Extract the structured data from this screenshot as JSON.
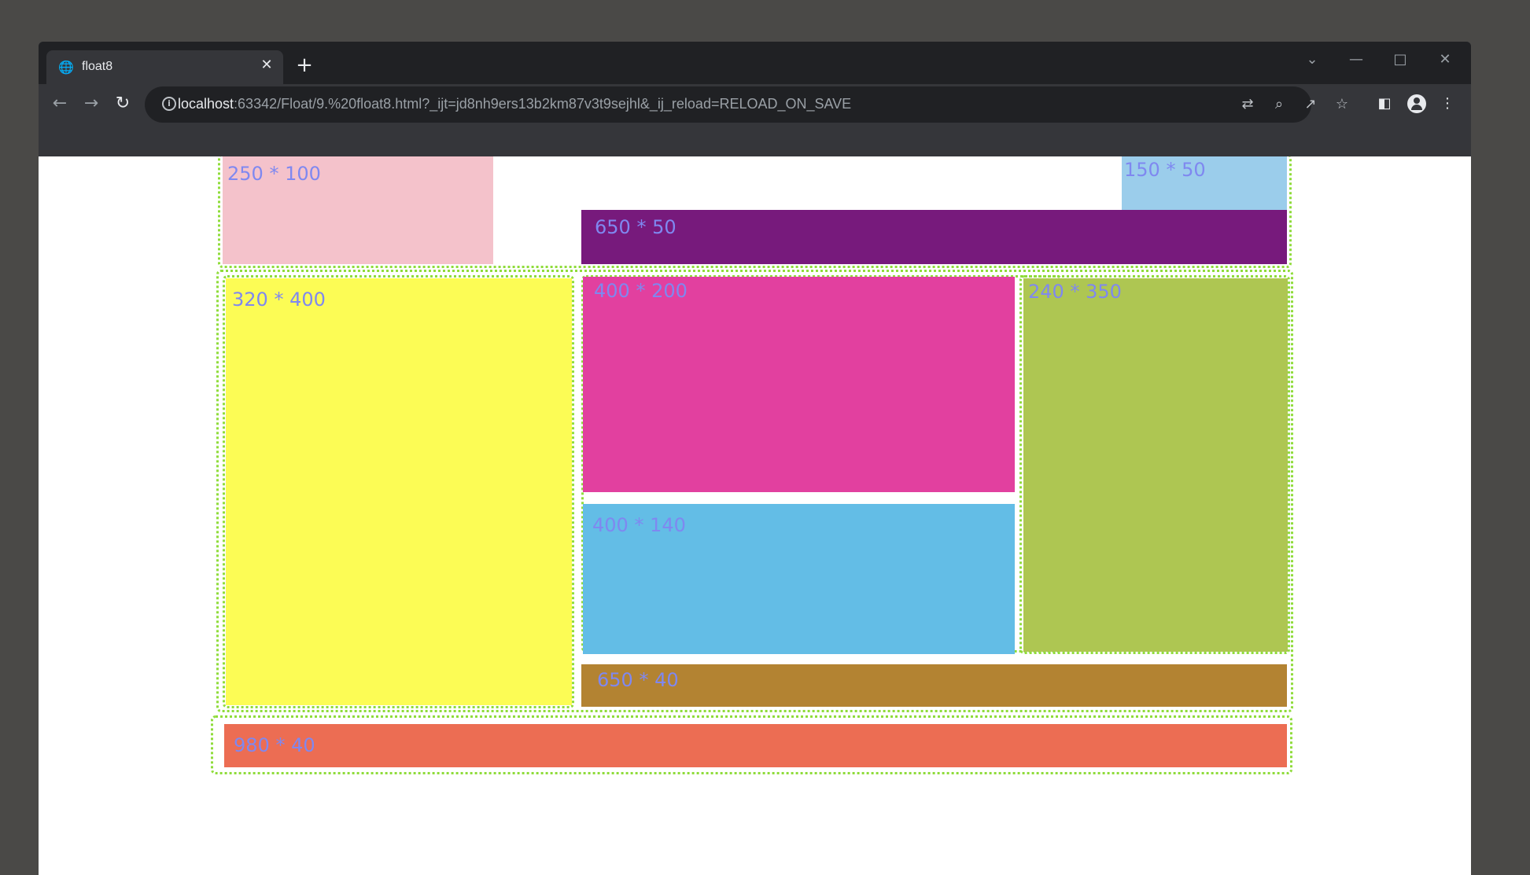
{
  "browser": {
    "tab_title": "float8",
    "url_host": "localhost",
    "url_rest": ":63342/Float/9.%20float8.html?_ijt=jd8nh9ers13b2km87v3t9sejhl&_ij_reload=RELOAD_ON_SAVE",
    "icons": {
      "tab_favicon": "globe-icon",
      "tab_close": "close-icon",
      "new_tab": "plus-icon",
      "back": "arrow-left-icon",
      "forward": "arrow-right-icon",
      "reload": "reload-icon",
      "site_info": "info-icon",
      "translate": "translate-icon",
      "zoom": "zoom-icon",
      "share": "share-icon",
      "bookmark": "star-icon",
      "side_panel": "side-panel-icon",
      "profile": "profile-icon",
      "menu": "kebab-menu-icon",
      "tab_search": "chevron-down-icon",
      "minimize": "minimize-icon",
      "maximize": "maximize-icon",
      "close_window": "close-window-icon"
    }
  },
  "page": {
    "boxes": {
      "pink": {
        "label": "250 * 100",
        "color": "#f4c2cb"
      },
      "light_blue": {
        "label": "150 * 50",
        "color": "#9bcdeb"
      },
      "purple": {
        "label": "650 * 50",
        "color": "#771a7c"
      },
      "yellow": {
        "label": "320 * 400",
        "color": "#fcfc55"
      },
      "magenta": {
        "label": "400 * 200",
        "color": "#e2409f"
      },
      "sky": {
        "label": "400 * 140",
        "color": "#63bde6"
      },
      "olive": {
        "label": "240 * 350",
        "color": "#aec652"
      },
      "brown": {
        "label": "650 * 40",
        "color": "#b38332"
      },
      "coral": {
        "label": "980 * 40",
        "color": "#ec6d53"
      }
    },
    "label_color": "#7f88f0",
    "outline_color": "#8fdc3a"
  }
}
